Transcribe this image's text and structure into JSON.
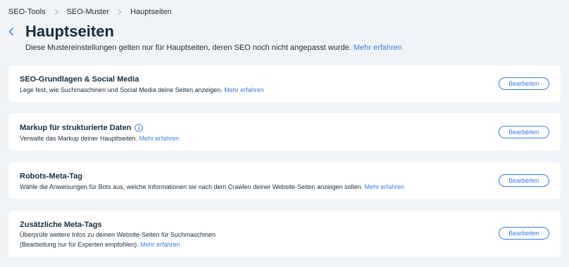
{
  "breadcrumb": {
    "items": [
      "SEO-Tools",
      "SEO-Muster",
      "Hauptseiten"
    ]
  },
  "header": {
    "title": "Hauptseiten",
    "subtitle": "Diese Mustereinstellungen gelten nur für Hauptseiten, deren SEO noch nicht angepasst wurde.",
    "subtitle_link": "Mehr erfahren"
  },
  "cards": [
    {
      "title": "SEO-Grundlagen & Social Media",
      "desc_lines": [
        "Lege fest, wie Suchmaschinen und Social Media deine Seiten anzeigen."
      ],
      "link": "Mehr erfahren",
      "button": "Bearbeiten"
    },
    {
      "title": "Markup für strukturierte Daten",
      "desc_lines": [
        "Verwalte das Markup deiner Haupttseiten."
      ],
      "link": "Mehr erfahren",
      "button": "Bearbeiten"
    },
    {
      "title": "Robots-Meta-Tag",
      "desc_lines": [
        "Wähle die Anweisungen für Bots aus, welche Informationen sie nach dem Crawlen deiner Website-Seiten anzeigen sollen."
      ],
      "link": "Mehr erfahren",
      "button": "Bearbeiten"
    },
    {
      "title": "Zusätzliche Meta-Tags",
      "desc_lines": [
        "Überprüfe weitere Infos zu deinen Website-Seiten für Suchmaschinen",
        "(Bearbeitung nur für Experten empfohlen)."
      ],
      "link": "Mehr erfahren",
      "button": "Bearbeiten"
    }
  ],
  "colors": {
    "background": "#f0f4f7",
    "accent": "#3b7de0",
    "title_text": "#162d3d"
  },
  "icons": {
    "back": "chevron-left-icon",
    "separator": "chevron-right-icon",
    "info": "info-icon"
  }
}
